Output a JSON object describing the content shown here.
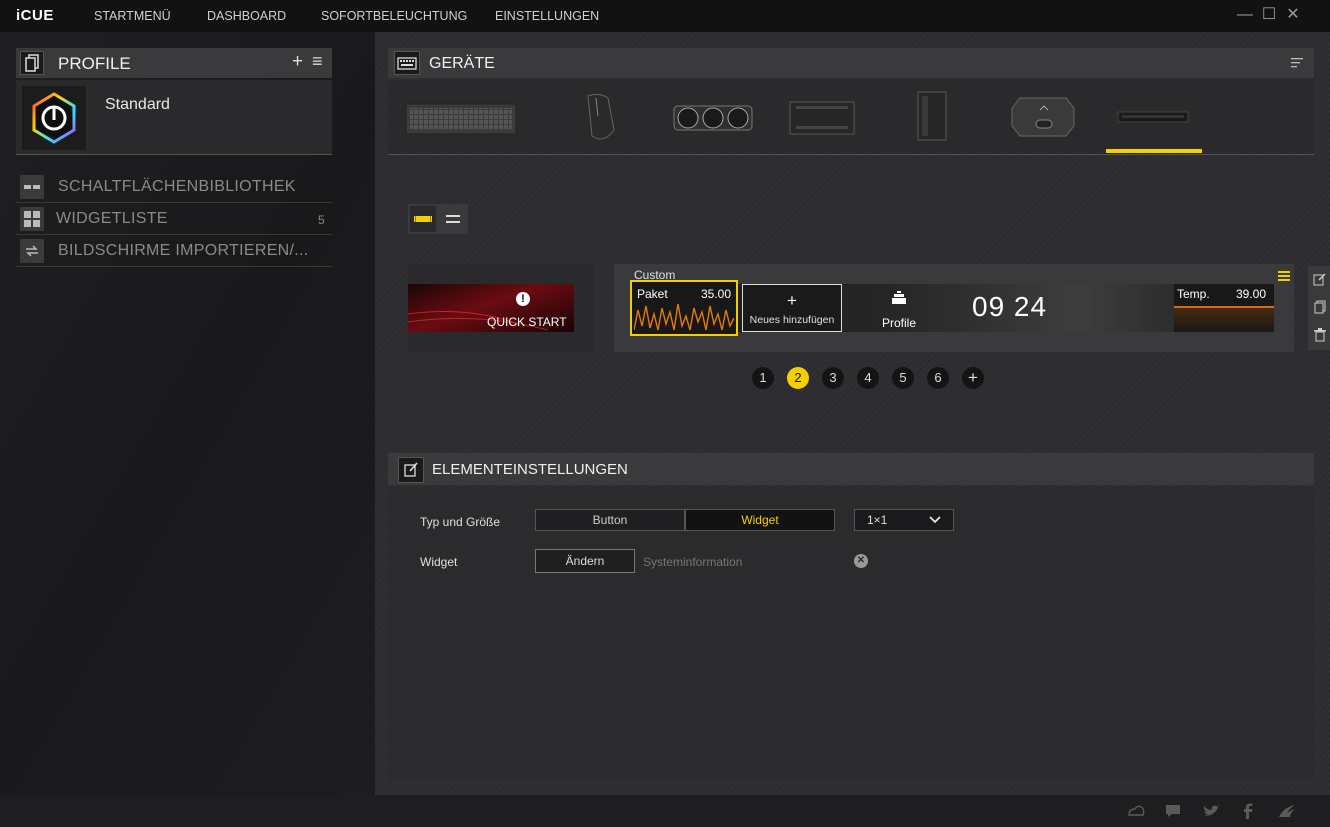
{
  "app": {
    "logo": "iCUE"
  },
  "nav": [
    "STARTMENÜ",
    "DASHBOARD",
    "SOFORTBELEUCHTUNG",
    "EINSTELLUNGEN"
  ],
  "window_controls": {
    "minimize": "—",
    "maximize": "☐",
    "close": "✕"
  },
  "profile_panel": {
    "title": "PROFILE",
    "add_icon": "+",
    "menu_icon": "≡",
    "profile_name": "Standard"
  },
  "sidebar": {
    "items": [
      {
        "label": "SCHALTFLÄCHENBIBLIOTHEK",
        "count": ""
      },
      {
        "label": "WIDGETLISTE",
        "count": "5"
      },
      {
        "label": "BILDSCHIRME IMPORTIEREN/...",
        "count": ""
      }
    ]
  },
  "devices_panel": {
    "title": "GERÄTE",
    "selected_index": 6
  },
  "lcd": {
    "quickstart_label": "QUICK START",
    "screen_title": "Custom",
    "widget_paket_label": "Paket",
    "widget_paket_value": "35.00",
    "add_new_label": "Neues hinzufügen",
    "profile_label": "Profile",
    "clock": "09 24",
    "temp_label": "Temp.",
    "temp_value": "39.00"
  },
  "pages": {
    "items": [
      "1",
      "2",
      "3",
      "4",
      "5",
      "6"
    ],
    "active": "2",
    "add": "+"
  },
  "settings": {
    "title": "ELEMENTEINSTELLUNGEN",
    "type_label": "Typ und Größe",
    "type_button": "Button",
    "type_widget": "Widget",
    "size_value": "1×1",
    "widget_label": "Widget",
    "change_button": "Ändern",
    "widget_name": "Systeminformation"
  },
  "colors": {
    "accent": "#f5d000",
    "bg": "#1c1c1e",
    "panel": "#3a3a3d"
  }
}
